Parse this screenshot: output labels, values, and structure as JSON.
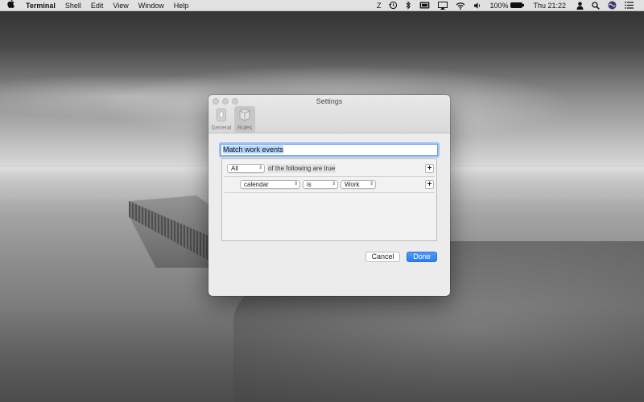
{
  "menubar": {
    "app_name": "Terminal",
    "menus": [
      "Shell",
      "Edit",
      "View",
      "Window",
      "Help"
    ],
    "status_items": {
      "input_source": "Z",
      "battery_percent": "100%",
      "clock": "Thu 21:22"
    },
    "icons": [
      "apple-icon",
      "time-machine-icon",
      "bluetooth-icon",
      "display-icon",
      "airplay-icon",
      "wifi-icon",
      "volume-icon",
      "battery-icon",
      "user-icon",
      "spotlight-icon",
      "siri-icon",
      "notification-center-icon"
    ]
  },
  "settings_window": {
    "title": "Settings",
    "toolbar_tabs": [
      {
        "label": "General",
        "icon": "general-icon",
        "selected": false
      },
      {
        "label": "Rules",
        "icon": "rules-icon",
        "selected": true
      }
    ],
    "rule_name": "Match work events",
    "header_row": {
      "match_select": "All",
      "text": "of the following are true"
    },
    "condition_row": {
      "field_select": "calendar",
      "operator_select": "is",
      "value_select": "Work"
    },
    "buttons": {
      "cancel": "Cancel",
      "done": "Done"
    },
    "accent_color": "#2a7ef0"
  }
}
